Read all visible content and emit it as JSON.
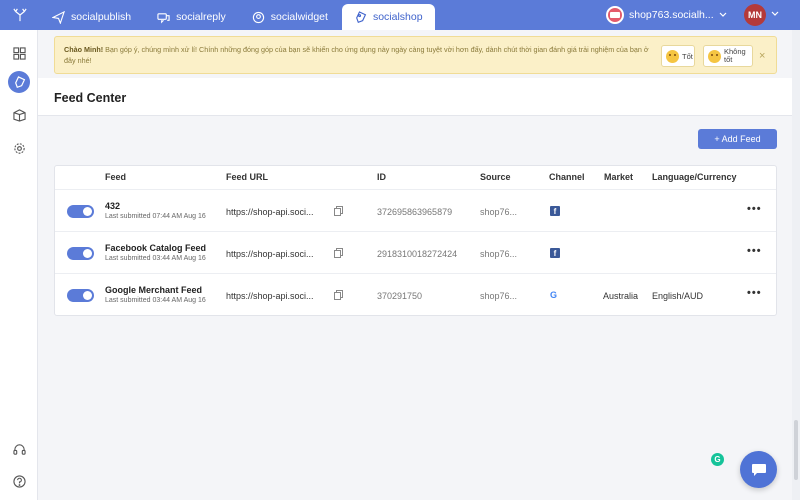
{
  "topbar": {
    "tabs": [
      {
        "label": "socialpublish",
        "icon": "paper-plane-icon"
      },
      {
        "label": "socialreply",
        "icon": "chat-bubbles-icon"
      },
      {
        "label": "socialwidget",
        "icon": "widget-pin-icon"
      },
      {
        "label": "socialshop",
        "icon": "tag-icon",
        "active": true
      }
    ],
    "shop_name": "shop763.socialh...",
    "avatar_initials": "MN"
  },
  "notice": {
    "greeting": "Chào Minh!",
    "message": " Bạn góp ý, chúng mình xử lí! Chính những đóng góp của bạn sẽ khiến cho ứng dụng này ngày càng tuyệt vời hơn đấy, dành chút thời gian đánh giá trải nghiệm của bạn ở đây nhé!",
    "good_label": "Tốt",
    "bad_label": "Không tốt",
    "close": "×"
  },
  "page": {
    "title": "Feed Center",
    "add_button": "+ Add Feed"
  },
  "table": {
    "headers": {
      "feed": "Feed",
      "feed_url": "Feed URL",
      "id": "ID",
      "source": "Source",
      "channel": "Channel",
      "market": "Market",
      "language": "Language/Currency"
    },
    "rows": [
      {
        "name": "432",
        "submitted": "Last submitted 07:44 AM Aug 16",
        "url": "https://shop-api.soci...",
        "id": "372695863965879",
        "source": "shop76...",
        "channel": "facebook",
        "market": "",
        "language": ""
      },
      {
        "name": "Facebook Catalog Feed",
        "submitted": "Last submitted 03:44 AM Aug 16",
        "url": "https://shop-api.soci...",
        "id": "2918310018272424",
        "source": "shop76...",
        "channel": "facebook",
        "market": "",
        "language": ""
      },
      {
        "name": "Google Merchant Feed",
        "submitted": "Last submitted 03:44 AM Aug 16",
        "url": "https://shop-api.soci...",
        "id": "370291750",
        "source": "shop76...",
        "channel": "google",
        "market": "Australia",
        "language": "English/AUD"
      }
    ],
    "more_label": "•••",
    "fb_glyph": "f",
    "google_glyph": "G"
  },
  "floating": {
    "grammarly_glyph": "G"
  },
  "colors": {
    "brand": "#5b7bd8",
    "notice_bg": "#fbf0c8"
  }
}
